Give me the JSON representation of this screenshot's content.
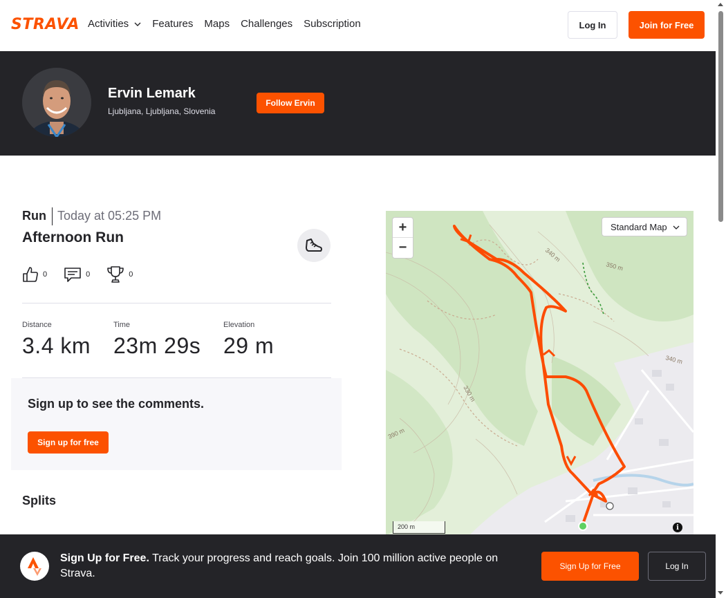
{
  "nav": {
    "logo": "STRAVA",
    "links": [
      "Activities",
      "Features",
      "Maps",
      "Challenges",
      "Subscription"
    ],
    "login_label": "Log In",
    "join_label": "Join for Free"
  },
  "athlete": {
    "name": "Ervin Lemark",
    "location": "Ljubljana, Ljubljana, Slovenia",
    "follow_label": "Follow Ervin"
  },
  "activity": {
    "type": "Run",
    "time": "Today at 05:25 PM",
    "title": "Afternoon Run",
    "kudos": "0",
    "comments": "0",
    "achievements": "0",
    "stats": [
      {
        "label": "Distance",
        "value": "3.4 km"
      },
      {
        "label": "Time",
        "value": "23m 29s"
      },
      {
        "label": "Elevation",
        "value": "29 m"
      }
    ]
  },
  "comments": {
    "title": "Sign up to see the comments.",
    "button": "Sign up for free"
  },
  "splits": {
    "title": "Splits"
  },
  "map": {
    "type_label": "Standard Map",
    "scale_label": "200 m",
    "contour_labels": [
      "340 m",
      "350 m",
      "330 m",
      "390 m",
      "340 m"
    ],
    "route_color": "#fc4c02"
  },
  "bottom_bar": {
    "headline": "Sign Up for Free.",
    "text": "Track your progress and reach goals. Join 100 million active people on Strava.",
    "signup_label": "Sign Up for Free",
    "login_label": "Log In"
  },
  "colors": {
    "brand": "#fc5200",
    "dark": "#242428"
  }
}
